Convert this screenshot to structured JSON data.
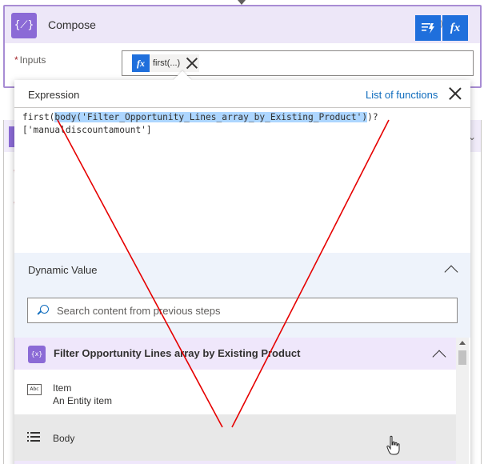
{
  "compose": {
    "icon_text": "{⟋}",
    "title": "Compose",
    "inputs_required_mark": "*",
    "inputs_label": "Inputs",
    "token": {
      "icon": "fx",
      "text": "first(...)"
    },
    "header_buttons": [
      {
        "icon": "add-dynamic-content-icon",
        "label": ""
      },
      {
        "icon": "fx",
        "label": "fx"
      }
    ]
  },
  "expression": {
    "title": "Expression",
    "list_functions": "List of functions",
    "code": {
      "prefix": "first(",
      "highlighted": "body('Filter_Opportunity_Lines_array_by_Existing_Product')",
      "suffix": ")?",
      "line2": "['manualdiscountamount']"
    }
  },
  "dynamic": {
    "title": "Dynamic Value",
    "search_placeholder": "Search content from previous steps",
    "group": {
      "icon_text": "{x}",
      "title": "Filter Opportunity Lines array by Existing Product"
    },
    "items": [
      {
        "icon": "Abc",
        "title": "Item",
        "description": "An Entity item"
      },
      {
        "icon": "list-icon",
        "title": "Body",
        "description": ""
      }
    ]
  },
  "colors": {
    "accent_blue": "#1f6fdc",
    "link_blue": "#0f6cbd",
    "purple": "#8b6ad6",
    "annotation_red": "#e60000",
    "highlight": "#add6ff"
  }
}
